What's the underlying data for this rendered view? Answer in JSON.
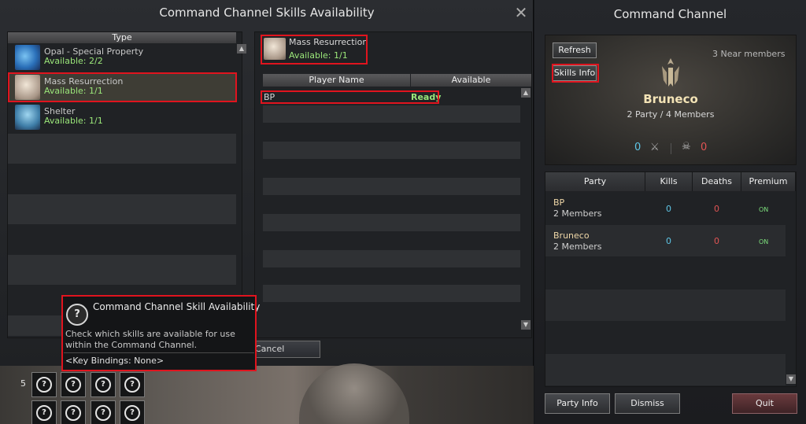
{
  "skills_window": {
    "title": "Command Channel Skills Availability",
    "close_label": "✕",
    "type_header": "Type",
    "skills": [
      {
        "name": "Opal - Special Property",
        "available": "Available: 2/2"
      },
      {
        "name": "Mass Resurrection",
        "available": "Available: 1/1"
      },
      {
        "name": "Shelter",
        "available": "Available: 1/1"
      }
    ],
    "detail": {
      "skill_name": "Mass Resurrection",
      "available": "Available: 1/1",
      "col_player": "Player Name",
      "col_available": "Available",
      "players": [
        {
          "name": "BP",
          "status": "Ready"
        }
      ]
    },
    "cancel_label": "Cancel"
  },
  "tooltip": {
    "title": "Command Channel Skill Availability",
    "description": "Check which skills are available for use within the Command Channel.",
    "key_bindings": "<Key Bindings: None>",
    "icon_glyph": "?"
  },
  "hotbar": {
    "slot_number": "5",
    "slot_glyph": "?"
  },
  "command_channel": {
    "title": "Command Channel",
    "refresh_label": "Refresh",
    "skills_info_label": "Skills Info",
    "near_members": "3 Near members",
    "leader": "Bruneco",
    "summary": "2 Party / 4 Members",
    "kills_total": "0",
    "deaths_total": "0",
    "icons": {
      "kills": "crossed-swords-icon",
      "deaths": "skull-icon"
    },
    "table_headers": {
      "party": "Party",
      "kills": "Kills",
      "deaths": "Deaths",
      "premium": "Premium"
    },
    "parties": [
      {
        "name": "BP",
        "members": "2 Members",
        "kills": "0",
        "deaths": "0",
        "premium": "ON"
      },
      {
        "name": "Bruneco",
        "members": "2 Members",
        "kills": "0",
        "deaths": "0",
        "premium": "ON"
      }
    ],
    "buttons": {
      "party_info": "Party Info",
      "dismiss": "Dismiss",
      "quit": "Quit"
    }
  },
  "colors": {
    "available_green": "#9be77a",
    "highlight_red": "#e0141e",
    "kills_blue": "#5ec6e6",
    "deaths_red": "#e15454",
    "leader_gold": "#f3e3b6"
  }
}
